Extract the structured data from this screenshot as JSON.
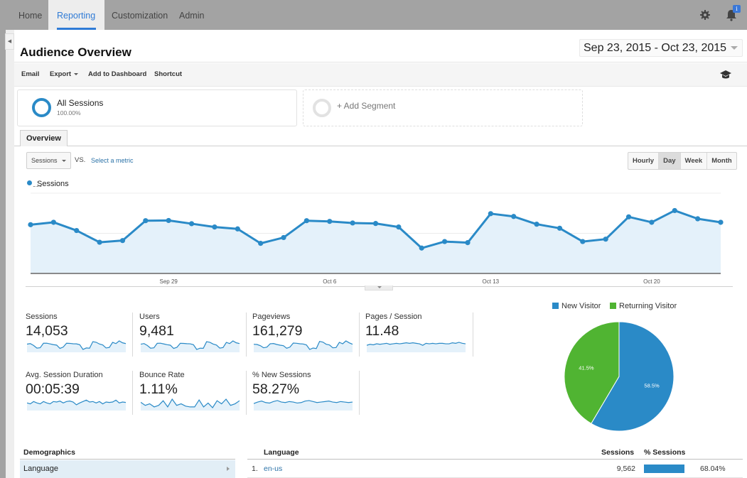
{
  "nav": {
    "tabs": [
      {
        "label": "Home",
        "active": false
      },
      {
        "label": "Reporting",
        "active": true
      },
      {
        "label": "Customization",
        "active": false
      },
      {
        "label": "Admin",
        "active": false
      }
    ],
    "settings_icon": "gear-icon",
    "notifications_icon": "bell-icon",
    "notification_badge": "i"
  },
  "header": {
    "title": "Audience Overview",
    "date_range": "Sep 23, 2015 - Oct 23, 2015"
  },
  "toolbar": {
    "email": "Email",
    "export": "Export",
    "add_to_dashboard": "Add to Dashboard",
    "shortcut": "Shortcut",
    "help_icon": "graduation-cap-icon"
  },
  "segments": {
    "all": {
      "name": "All Sessions",
      "percent": "100.00%"
    },
    "add": {
      "label": "+ Add Segment"
    }
  },
  "tabs": {
    "overview": "Overview"
  },
  "controls": {
    "metric": "Sessions",
    "vs": "VS.",
    "select_metric": "Select a metric",
    "granularity": [
      {
        "label": "Hourly",
        "active": false
      },
      {
        "label": "Day",
        "active": true
      },
      {
        "label": "Week",
        "active": false
      },
      {
        "label": "Month",
        "active": false
      }
    ]
  },
  "colors": {
    "primary": "#2a8ac7",
    "area_fill": "#e4f1fa",
    "green": "#50b432",
    "link": "#2c73a8",
    "nav_active": "#2f7bd6"
  },
  "chart_data": [
    {
      "type": "area",
      "title": "",
      "legend": [
        "Sessions"
      ],
      "xlabel": "",
      "ylabel": "",
      "ylim": [
        0,
        800
      ],
      "yticks": [
        400,
        800
      ],
      "x": [
        "Sep 23",
        "Sep 24",
        "Sep 25",
        "Sep 26",
        "Sep 27",
        "Sep 28",
        "Sep 29",
        "Sep 30",
        "Oct 1",
        "Oct 2",
        "Oct 3",
        "Oct 4",
        "Oct 5",
        "Oct 6",
        "Oct 7",
        "Oct 8",
        "Oct 9",
        "Oct 10",
        "Oct 11",
        "Oct 12",
        "Oct 13",
        "Oct 14",
        "Oct 15",
        "Oct 16",
        "Oct 17",
        "Oct 18",
        "Oct 19",
        "Oct 20",
        "Oct 21",
        "Oct 22",
        "Oct 23"
      ],
      "xticks": [
        "Sep 29",
        "Oct 6",
        "Oct 13",
        "Oct 20"
      ],
      "series": [
        {
          "name": "Sessions",
          "values": [
            486,
            510,
            428,
            311,
            328,
            526,
            528,
            496,
            463,
            444,
            300,
            358,
            526,
            519,
            503,
            498,
            463,
            253,
            318,
            307,
            596,
            568,
            491,
            451,
            318,
            342,
            564,
            510,
            627,
            545,
            510
          ]
        }
      ],
      "grid": true
    },
    {
      "type": "pie",
      "title": "",
      "legend": [
        "New Visitor",
        "Returning Visitor"
      ],
      "legend_position": "top",
      "slices": [
        {
          "label": "New Visitor",
          "value": 58.5,
          "display": "58.5%",
          "color": "#2a8ac7"
        },
        {
          "label": "Returning Visitor",
          "value": 41.5,
          "display": "41.5%",
          "color": "#50b432"
        }
      ]
    }
  ],
  "metrics": [
    {
      "label": "Sessions",
      "value": "14,053",
      "spark": [
        486,
        510,
        428,
        311,
        328,
        526,
        528,
        496,
        463,
        444,
        300,
        358,
        526,
        519,
        503,
        498,
        463,
        253,
        318,
        307,
        596,
        568,
        491,
        451,
        318,
        342,
        564,
        510,
        627,
        545,
        510
      ]
    },
    {
      "label": "Users",
      "value": "9,481",
      "spark": [
        480,
        505,
        430,
        320,
        335,
        515,
        520,
        490,
        460,
        440,
        310,
        355,
        515,
        510,
        500,
        495,
        460,
        270,
        320,
        315,
        580,
        555,
        485,
        445,
        325,
        345,
        550,
        505,
        610,
        535,
        505
      ]
    },
    {
      "label": "Pageviews",
      "value": "161,279",
      "spark": [
        480,
        470,
        420,
        330,
        360,
        500,
        510,
        470,
        440,
        420,
        310,
        360,
        530,
        520,
        500,
        490,
        450,
        260,
        320,
        300,
        600,
        570,
        480,
        450,
        330,
        340,
        560,
        500,
        620,
        540,
        480
      ]
    },
    {
      "label": "Pages / Session",
      "value": "11.48",
      "spark": [
        11.2,
        11.4,
        11.3,
        11.5,
        11.4,
        11.5,
        11.6,
        11.4,
        11.5,
        11.6,
        11.5,
        11.6,
        11.7,
        11.6,
        11.7,
        11.6,
        11.5,
        11.2,
        11.6,
        11.5,
        11.6,
        11.5,
        11.6,
        11.6,
        11.5,
        11.5,
        11.7,
        11.6,
        11.8,
        11.6,
        11.5
      ]
    },
    {
      "label": "Avg. Session Duration",
      "value": "00:05:39",
      "spark": [
        330,
        320,
        345,
        330,
        320,
        345,
        330,
        320,
        345,
        340,
        350,
        330,
        345,
        350,
        340,
        310,
        330,
        345,
        360,
        340,
        345,
        330,
        345,
        320,
        340,
        335,
        340,
        360,
        330,
        340,
        335
      ]
    },
    {
      "label": "Bounce Rate",
      "value": "1.11%",
      "spark": [
        1.2,
        1.0,
        1.1,
        0.9,
        1.0,
        1.3,
        0.9,
        1.4,
        1.0,
        1.1,
        0.95,
        0.9,
        0.9,
        1.35,
        0.9,
        1.15,
        0.85,
        1.3,
        1.1,
        1.4,
        1.0,
        1.1,
        1.3
      ]
    },
    {
      "label": "% New Sessions",
      "value": "58.27%",
      "spark": [
        57.8,
        58.1,
        58.3,
        58.0,
        57.9,
        58.2,
        58.4,
        58.1,
        58.0,
        58.2,
        58.1,
        57.9,
        58.0,
        58.3,
        58.4,
        58.2,
        58.0,
        58.1,
        58.2,
        58.3,
        58.1,
        58.0,
        58.2,
        58.1,
        58.0,
        58.1
      ]
    }
  ],
  "demographics": {
    "heading": "Demographics",
    "selected": "Language"
  },
  "language_table": {
    "headers": {
      "name": "Language",
      "sessions": "Sessions",
      "pct": "% Sessions"
    },
    "rows": [
      {
        "rank": "1.",
        "name": "en-us",
        "sessions": "9,562",
        "pct": "68.04%",
        "pct_value": 68.04
      }
    ]
  }
}
